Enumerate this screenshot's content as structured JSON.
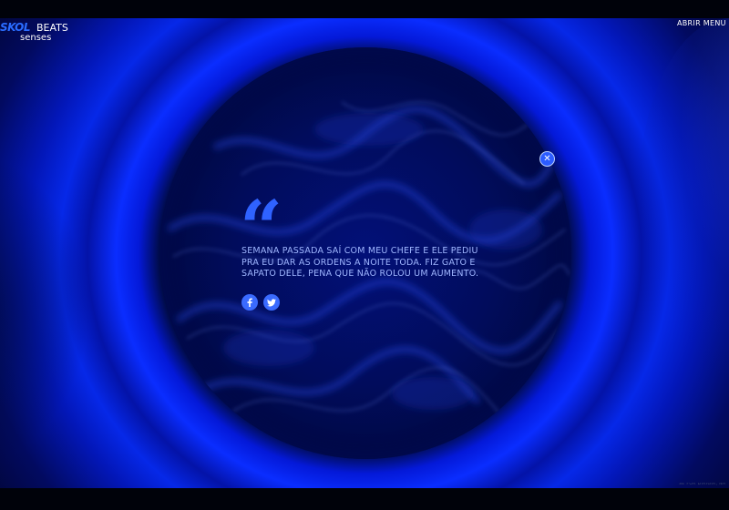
{
  "brand": {
    "name_part1": "SKOL",
    "name_part2": "BEATS",
    "name_part3": "senses"
  },
  "header": {
    "menu_label": "ABRIR MENU"
  },
  "modal": {
    "quote_mark": "“",
    "quote_text": "SEMANA PASSADA SAÍ COM MEU CHEFE E ELE PEDIU PRA EU DAR AS ORDENS A NOITE TODA. FIZ GATO E SAPATO DELE, PENA QUE NÃO ROLOU UM AUMENTO.",
    "close_glyph": "✕",
    "share": [
      {
        "network": "facebook",
        "glyph": "f",
        "icon": "facebook-icon"
      },
      {
        "network": "twitter",
        "glyph": "🐦",
        "icon": "twitter-icon"
      }
    ]
  },
  "footer": {
    "disclaimer": "SE FOR DIRIGIR, NÃ"
  },
  "colors": {
    "accent": "#2f62ff",
    "text_light": "#9fb6ff",
    "background": "#00030d"
  }
}
